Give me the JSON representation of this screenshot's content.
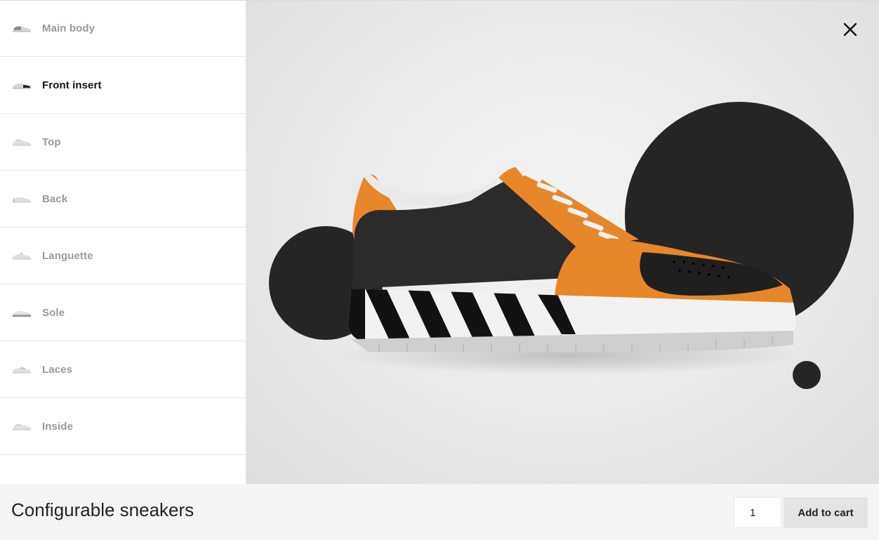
{
  "sidebar": {
    "items": [
      {
        "label": "Main body",
        "icon": "shoe-thumb-main-body-icon",
        "active": false
      },
      {
        "label": "Front insert",
        "icon": "shoe-thumb-front-insert-icon",
        "active": true
      },
      {
        "label": "Top",
        "icon": "shoe-thumb-top-icon",
        "active": false
      },
      {
        "label": "Back",
        "icon": "shoe-thumb-back-icon",
        "active": false
      },
      {
        "label": "Languette",
        "icon": "shoe-thumb-languette-icon",
        "active": false
      },
      {
        "label": "Sole",
        "icon": "shoe-thumb-sole-icon",
        "active": false
      },
      {
        "label": "Laces",
        "icon": "shoe-thumb-laces-icon",
        "active": false
      },
      {
        "label": "Inside",
        "icon": "shoe-thumb-inside-icon",
        "active": false
      }
    ]
  },
  "preview": {
    "close_icon": "close-icon",
    "colors": {
      "background": "#e9e9e9",
      "circles": "#252525",
      "upper": "#2a2a2a",
      "accent_orange": "#e8862a",
      "sole": "#f2f2f2",
      "stripes": "#111111"
    }
  },
  "footer": {
    "title": "Configurable sneakers",
    "quantity": "1",
    "add_to_cart_label": "Add to cart"
  }
}
